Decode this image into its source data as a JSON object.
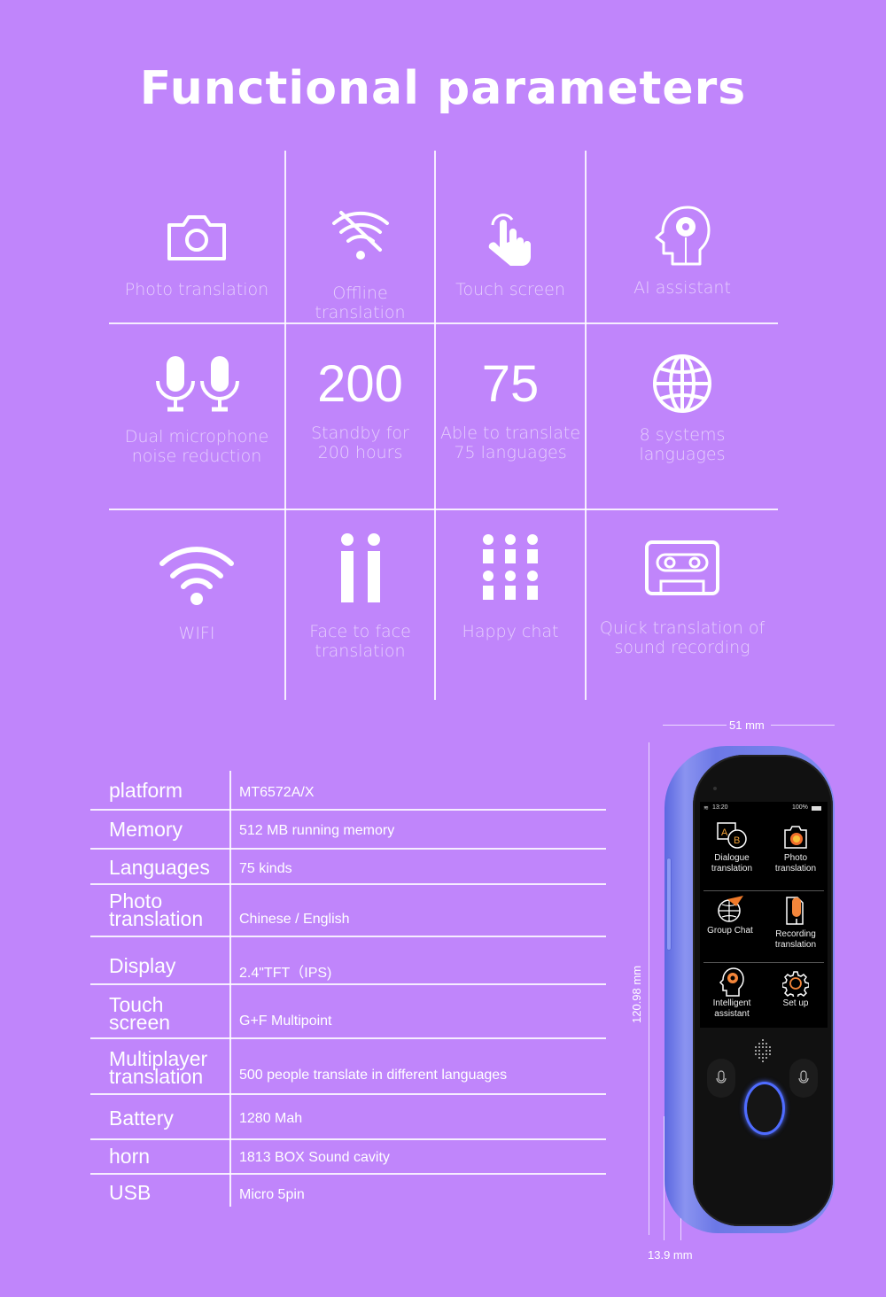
{
  "title": "Functional parameters",
  "colors": {
    "background": "#c085fb",
    "text": "#ffffff",
    "label_text": "rgba(255,255,255,0.6)",
    "button_ring": "#4f6cff"
  },
  "features": [
    {
      "icon": "camera-icon",
      "label": "Photo translation"
    },
    {
      "icon": "wifi-off-icon",
      "label": "Offline translation"
    },
    {
      "icon": "touch-hand-icon",
      "label": "Touch screen"
    },
    {
      "icon": "ai-head-gear-icon",
      "label": "AI assistant"
    },
    {
      "icon": "dual-microphone-icon",
      "label_line1": "Dual microphone",
      "label_line2": "noise reduction"
    },
    {
      "big": "200",
      "label_line1": "Standby for",
      "label_line2": "200 hours"
    },
    {
      "big": "75",
      "label_line1": "Able to translate",
      "label_line2": "75 languages"
    },
    {
      "icon": "globe-icon",
      "label_line1": "8 systems",
      "label_line2": "languages"
    },
    {
      "icon": "wifi-icon",
      "label": "WIFI"
    },
    {
      "icon": "face-to-face-icon",
      "label_line1": "Face to face",
      "label_line2": "translation"
    },
    {
      "icon": "group-people-icon",
      "label": "Happy chat"
    },
    {
      "icon": "cassette-icon",
      "label_line1": "Quick translation of",
      "label_line2": "sound recording"
    }
  ],
  "specs": [
    {
      "key": "platform",
      "value": "MT6572A/X"
    },
    {
      "key": "Memory",
      "value": "512 MB  running memory"
    },
    {
      "key": "Languages",
      "value": "75 kinds"
    },
    {
      "key_line1": "Photo",
      "key_line2": "translation",
      "value": "Chinese / English"
    },
    {
      "key": "Display",
      "value": "2.4\"TFT（IPS)"
    },
    {
      "key_line1": "Touch",
      "key_line2": "screen",
      "value": "G+F Multipoint"
    },
    {
      "key_line1": "Multiplayer",
      "key_line2": "translation",
      "value": "500 people translate in different languages"
    },
    {
      "key": "Battery",
      "value": "1280 Mah"
    },
    {
      "key": "horn",
      "value": "1813 BOX Sound cavity"
    },
    {
      "key": "USB",
      "value": "Micro 5pin"
    }
  ],
  "device": {
    "width_label": "51 mm",
    "height_label": "120.98 mm",
    "depth_label": "13.9 mm",
    "status_time": "13:20",
    "status_battery": "100%",
    "apps": [
      {
        "line1": "Dialogue",
        "line2": "translation"
      },
      {
        "line1": "Photo",
        "line2": "translation"
      },
      {
        "line1": "Group Chat",
        "line2": ""
      },
      {
        "line1": "Recording",
        "line2": "translation"
      },
      {
        "line1": "Intelligent",
        "line2": "assistant"
      },
      {
        "line1": "Set up",
        "line2": ""
      }
    ]
  }
}
